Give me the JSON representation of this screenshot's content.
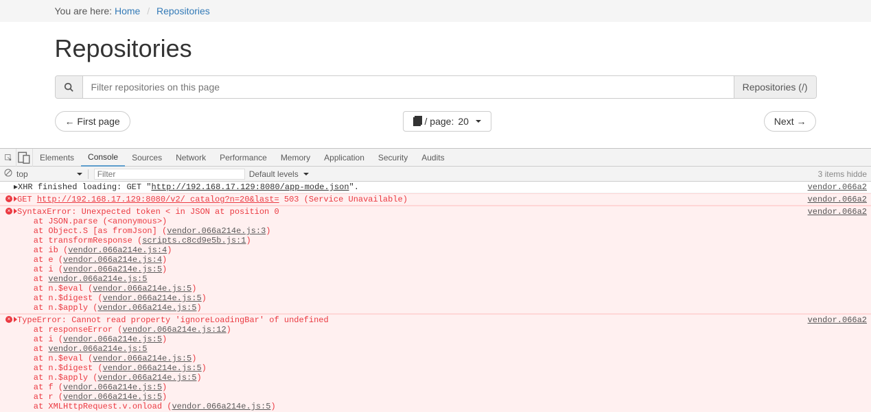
{
  "breadcrumb": {
    "prefix": "You are here:",
    "home": "Home",
    "current": "Repositories"
  },
  "page": {
    "title": "Repositories"
  },
  "search": {
    "placeholder": "Filter repositories on this page",
    "right_label": "Repositories (/)"
  },
  "pager": {
    "first": "← First page",
    "per_page_prefix": "/ page:",
    "per_page_value": "20",
    "next": "Next →"
  },
  "devtools": {
    "tabs": [
      "Elements",
      "Console",
      "Sources",
      "Network",
      "Performance",
      "Memory",
      "Application",
      "Security",
      "Audits"
    ],
    "active_tab": "Console",
    "filter_row": {
      "context": "top",
      "filter_placeholder": "Filter",
      "levels": "Default levels",
      "hidden": "3 items hidde"
    },
    "logs": [
      {
        "type": "info",
        "text_parts": [
          {
            "t": "▸XHR finished loading: GET \"",
            "c": "plain"
          },
          {
            "t": "http://192.168.17.129:8080/app-mode.json",
            "c": "link"
          },
          {
            "t": "\".",
            "c": "plain"
          }
        ],
        "src": "vendor.066a2"
      },
      {
        "type": "error",
        "expandable": true,
        "text_parts": [
          {
            "t": "GET ",
            "c": "err"
          },
          {
            "t": "http://192.168.17.129:8080/v2/ catalog?n=20&last=",
            "c": "errlink"
          },
          {
            "t": " 503 (Service Unavailable)",
            "c": "err"
          }
        ],
        "src": "vendor.066a2"
      },
      {
        "type": "error",
        "expandable": true,
        "text_parts": [
          {
            "t": "SyntaxError: Unexpected token < in JSON at position 0",
            "c": "err"
          }
        ],
        "stack": [
          "    at JSON.parse (<anonymous>)",
          "    at Object.S [as fromJson] (vendor.066a214e.js:3)",
          "    at transformResponse (scripts.c8cd9e5b.js:1)",
          "    at ib (vendor.066a214e.js:4)",
          "    at e (vendor.066a214e.js:4)",
          "    at i (vendor.066a214e.js:5)",
          "    at vendor.066a214e.js:5",
          "    at n.$eval (vendor.066a214e.js:5)",
          "    at n.$digest (vendor.066a214e.js:5)",
          "    at n.$apply (vendor.066a214e.js:5)"
        ],
        "src": "vendor.066a2"
      },
      {
        "type": "error",
        "expandable": true,
        "text_parts": [
          {
            "t": "TypeError: Cannot read property 'ignoreLoadingBar' of undefined",
            "c": "err"
          }
        ],
        "stack": [
          "    at responseError (vendor.066a214e.js:12)",
          "    at i (vendor.066a214e.js:5)",
          "    at vendor.066a214e.js:5",
          "    at n.$eval (vendor.066a214e.js:5)",
          "    at n.$digest (vendor.066a214e.js:5)",
          "    at n.$apply (vendor.066a214e.js:5)",
          "    at f (vendor.066a214e.js:5)",
          "    at r (vendor.066a214e.js:5)",
          "    at XMLHttpRequest.v.onload (vendor.066a214e.js:5)"
        ],
        "src": "vendor.066a2"
      }
    ]
  }
}
